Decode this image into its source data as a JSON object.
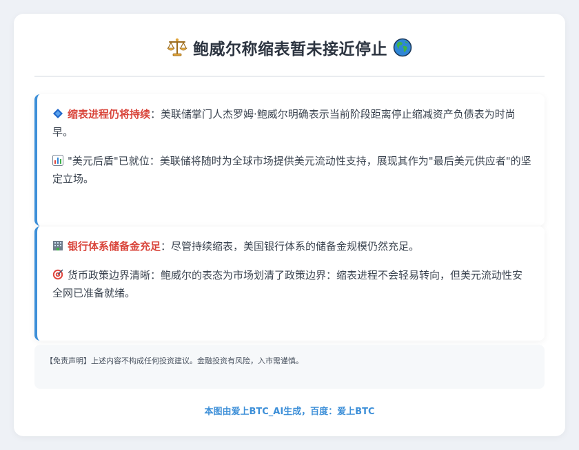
{
  "header": {
    "title": "鲍威尔称缩表暂未接近停止",
    "left_icon": "balance-scale-icon",
    "right_icon": "globe-icon"
  },
  "sections": [
    {
      "items": [
        {
          "icon": "blue-diamond-icon",
          "highlight": "缩表进程仍将持续",
          "text": "：美联储掌门人杰罗姆·鲍威尔明确表示当前阶段距离停止缩减资产负债表为时尚早。"
        },
        {
          "icon": "bar-chart-icon",
          "highlight": "",
          "text": "\"美元后盾\"已就位：美联储将随时为全球市场提供美元流动性支持，展现其作为\"最后美元供应者\"的坚定立场。"
        }
      ]
    },
    {
      "items": [
        {
          "icon": "bank-icon",
          "highlight": "银行体系储备金充足",
          "text": "：尽管持续缩表，美国银行体系的储备金规模仍然充足。"
        },
        {
          "icon": "target-icon",
          "highlight": "",
          "text": "货币政策边界清晰：鲍威尔的表态为市场划清了政策边界：缩表进程不会轻易转向，但美元流动性安全网已准备就绪。"
        }
      ]
    }
  ],
  "disclaimer": "【免责声明】上述内容不构成任何投资建议。金融投资有风险，入市需谨慎。",
  "footer": "本图由爱上BTC_AI生成，百度：爱上BTC",
  "colors": {
    "accent": "#3d8fd8",
    "highlight": "#d9453b",
    "background": "#eef1f6"
  }
}
